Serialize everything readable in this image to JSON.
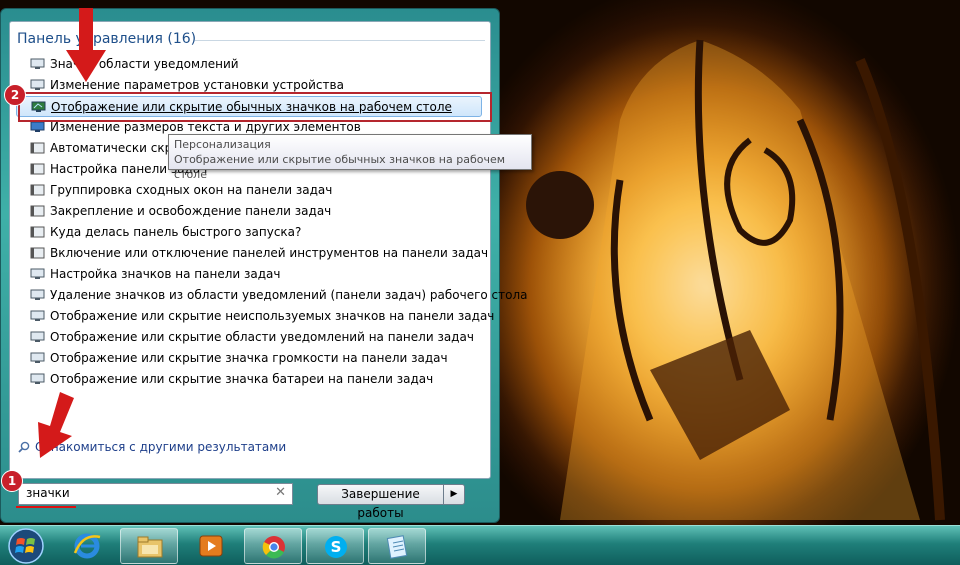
{
  "start_menu": {
    "category_header": "Панель управления (16)",
    "items": [
      {
        "label": "Значки области уведомлений",
        "icon": "monitor-icon"
      },
      {
        "label": "Изменение параметров установки устройства",
        "icon": "monitor-icon"
      },
      {
        "label": "Отображение или скрытие обычных значков на рабочем столе",
        "icon": "personalization-icon"
      },
      {
        "label": "Изменение размеров текста и других элементов",
        "icon": "display-icon"
      },
      {
        "label": "Автоматически скрывать панель задач",
        "icon": "taskbar-icon"
      },
      {
        "label": "Настройка панели задач",
        "icon": "taskbar-icon"
      },
      {
        "label": "Группировка сходных окон на панели задач",
        "icon": "taskbar-icon"
      },
      {
        "label": "Закрепление и освобождение панели задач",
        "icon": "taskbar-icon"
      },
      {
        "label": "Куда делась панель быстрого запуска?",
        "icon": "taskbar-icon"
      },
      {
        "label": "Включение или отключение панелей инструментов на панели задач",
        "icon": "taskbar-icon"
      },
      {
        "label": "Настройка значков на панели задач",
        "icon": "monitor-icon"
      },
      {
        "label": "Удаление значков из области уведомлений (панели задач) рабочего стола",
        "icon": "monitor-icon"
      },
      {
        "label": "Отображение или скрытие неиспользуемых значков на панели задач",
        "icon": "monitor-icon"
      },
      {
        "label": "Отображение или скрытие области уведомлений на панели задач",
        "icon": "monitor-icon"
      },
      {
        "label": "Отображение или скрытие значка громкости на панели задач",
        "icon": "monitor-icon"
      },
      {
        "label": "Отображение или скрытие значка батареи на панели задач",
        "icon": "monitor-icon"
      }
    ],
    "selected_index": 2,
    "tooltip": {
      "title": "Персонализация",
      "description": "Отображение или скрытие обычных значков на рабочем столе"
    },
    "see_more": "Ознакомиться с другими результатами",
    "search": {
      "value": "значки"
    },
    "shutdown_label": "Завершение работы"
  },
  "annotations": {
    "badge_1": "1",
    "badge_2": "2",
    "accent": "#c8202a"
  },
  "taskbar": {
    "items": [
      "start-orb",
      "internet-explorer-icon",
      "file-explorer-icon",
      "media-player-icon",
      "chrome-icon",
      "skype-icon",
      "notepad-icon"
    ]
  }
}
